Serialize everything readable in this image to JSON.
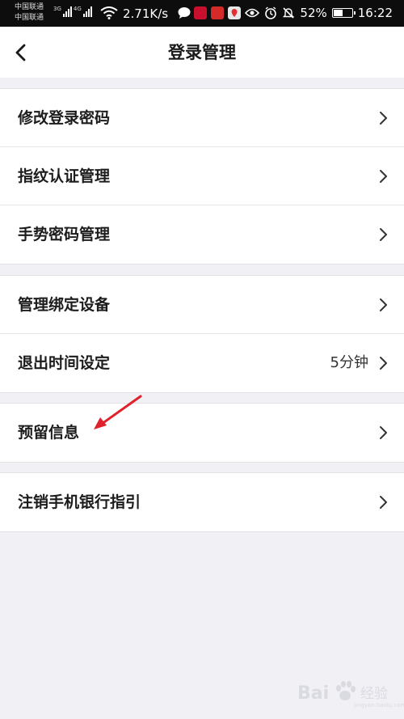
{
  "status_bar": {
    "carrier_1": "中国联通",
    "carrier_2": "中国联通",
    "network_1": "3G",
    "network_2": "4G",
    "speed": "2.71K/s",
    "battery": "52%",
    "battery_level": 0.52,
    "time": "16:22",
    "icons": [
      "signal-icon",
      "wifi-icon",
      "chat-icon",
      "app-notification-icon",
      "app-notification-icon",
      "location-app-icon",
      "eye-icon",
      "alarm-icon",
      "mute-icon",
      "battery-icon"
    ]
  },
  "nav": {
    "title": "登录管理",
    "back_icon": "chevron-left-icon"
  },
  "groups": [
    {
      "items": [
        {
          "label": "修改登录密码",
          "value": ""
        },
        {
          "label": "指纹认证管理",
          "value": ""
        },
        {
          "label": "手势密码管理",
          "value": ""
        }
      ]
    },
    {
      "items": [
        {
          "label": "管理绑定设备",
          "value": ""
        },
        {
          "label": "退出时间设定",
          "value": "5分钟"
        }
      ]
    },
    {
      "items": [
        {
          "label": "预留信息",
          "value": ""
        }
      ]
    },
    {
      "items": [
        {
          "label": "注销手机银行指引",
          "value": ""
        }
      ]
    }
  ],
  "annotation": {
    "icon": "red-arrow-icon",
    "color": "#e0202a"
  },
  "watermark": {
    "text": "Bai",
    "sub": "经验",
    "url": "jingyan.baidu.com"
  },
  "colors": {
    "background": "#f0f0f5",
    "text": "#1c1c1c",
    "chevron": "#333333"
  }
}
